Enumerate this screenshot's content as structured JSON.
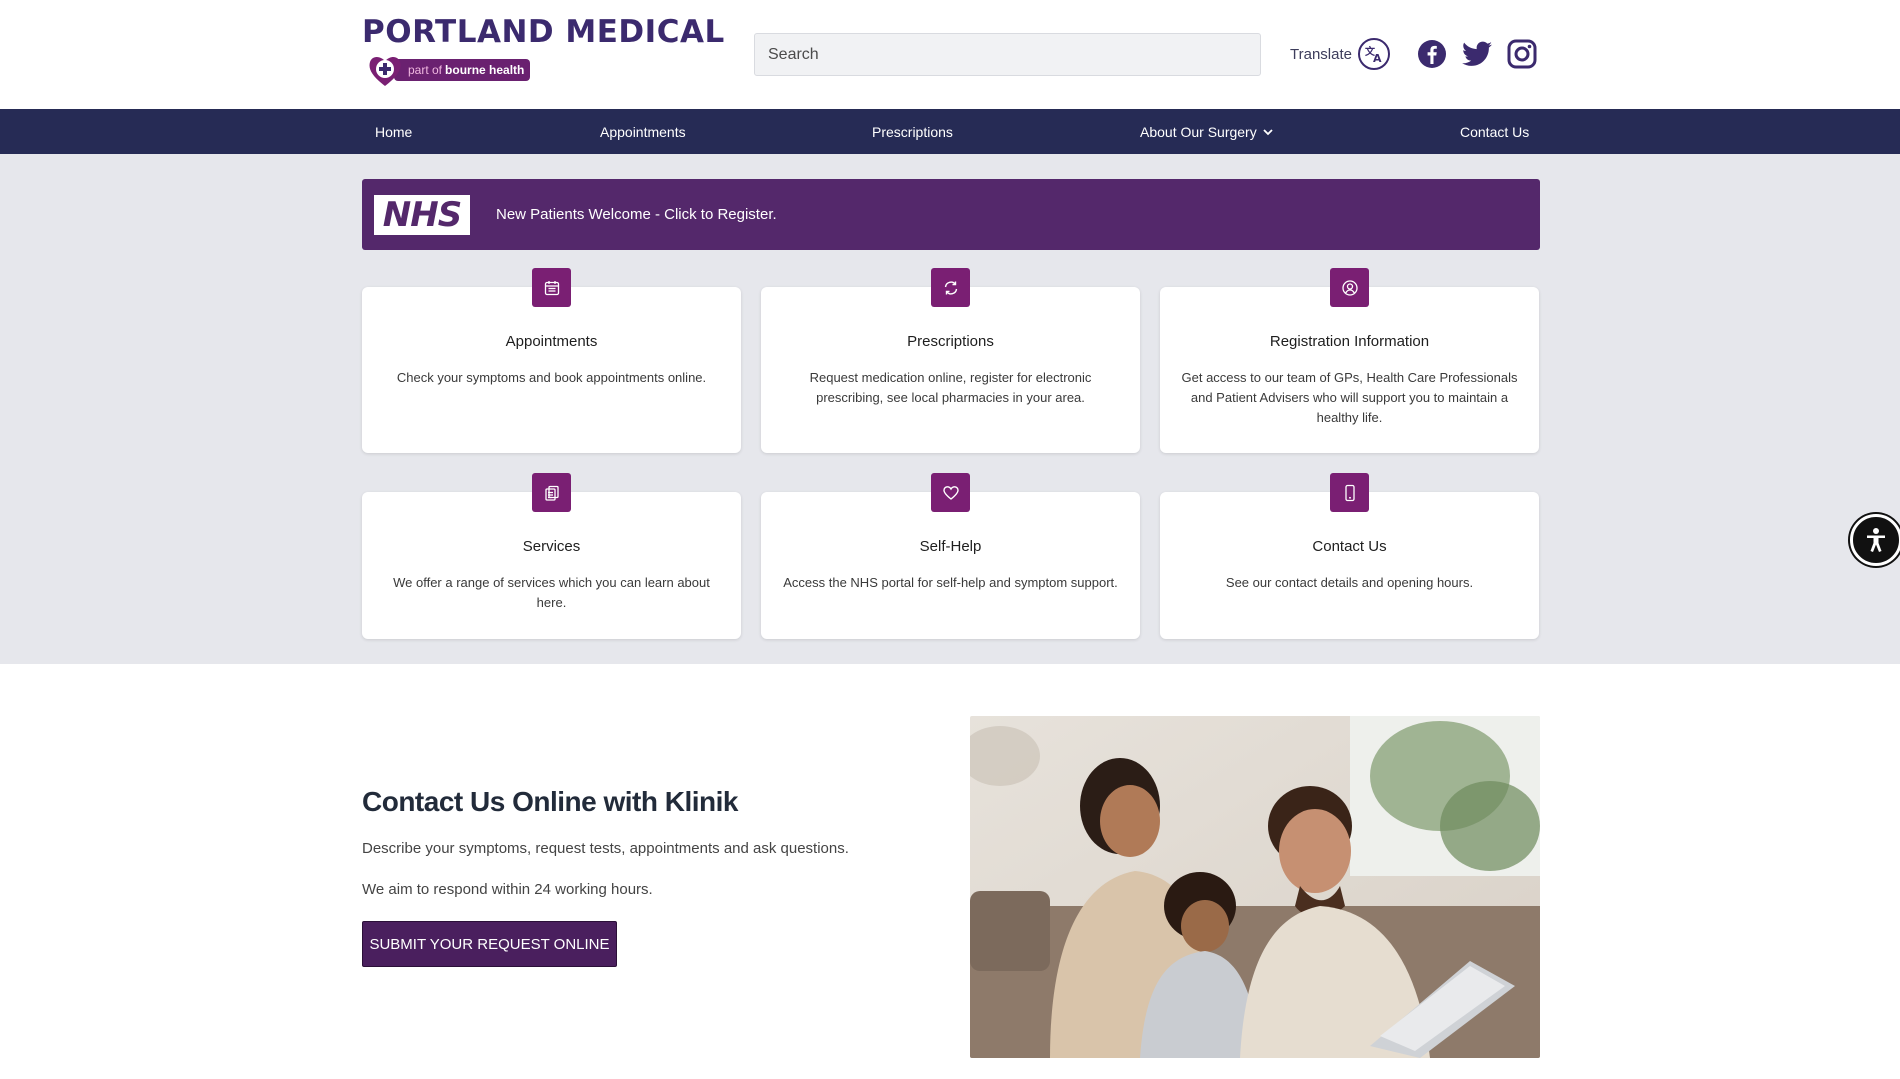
{
  "header": {
    "title": "PORTLAND MEDICAL",
    "subtitle_part": "part of",
    "subtitle_brand": "bourne health",
    "search_placeholder": "Search",
    "translate_label": "Translate",
    "social": [
      "facebook-icon",
      "twitter-icon",
      "instagram-icon"
    ],
    "colors": {
      "brand": "#3b2a6e",
      "accent": "#7a1f73"
    }
  },
  "nav": {
    "items": [
      {
        "label": "Home"
      },
      {
        "label": "Appointments"
      },
      {
        "label": "Prescriptions"
      },
      {
        "label": "About Our Surgery",
        "has_dropdown": true
      },
      {
        "label": "Contact Us"
      }
    ],
    "background": "#262b55"
  },
  "banner": {
    "logo_text": "NHS",
    "text": "New Patients Welcome - Click to Register.",
    "background": "#54286b"
  },
  "cards": [
    {
      "icon": "calendar-icon",
      "title": "Appointments",
      "description": "Check your symptoms and book appointments online."
    },
    {
      "icon": "refresh-icon",
      "title": "Prescriptions",
      "description": "Request medication online, register for electronic prescribing, see local pharmacies in your area."
    },
    {
      "icon": "user-circle-icon",
      "title": "Registration Information",
      "description": "Get access to our team of GPs, Health Care Professionals and Patient Advisers who will support you to maintain a healthy life."
    },
    {
      "icon": "clipboard-icon",
      "title": "Services",
      "description": "We offer a range of services which you can learn about here."
    },
    {
      "icon": "heart-icon",
      "title": "Self-Help",
      "description": "Access the NHS portal for self-help and symptom support."
    },
    {
      "icon": "phone-icon",
      "title": "Contact Us",
      "description": "See our contact details and opening hours."
    }
  ],
  "klinik": {
    "title": "Contact Us Online with Klinik",
    "description_1": "Describe your symptoms, request tests, appointments and ask questions.",
    "description_2": "We aim to respond within 24 working hours.",
    "button_label": "SUBMIT YOUR REQUEST ONLINE"
  },
  "accessibility": {
    "icon": "accessibility-icon"
  }
}
